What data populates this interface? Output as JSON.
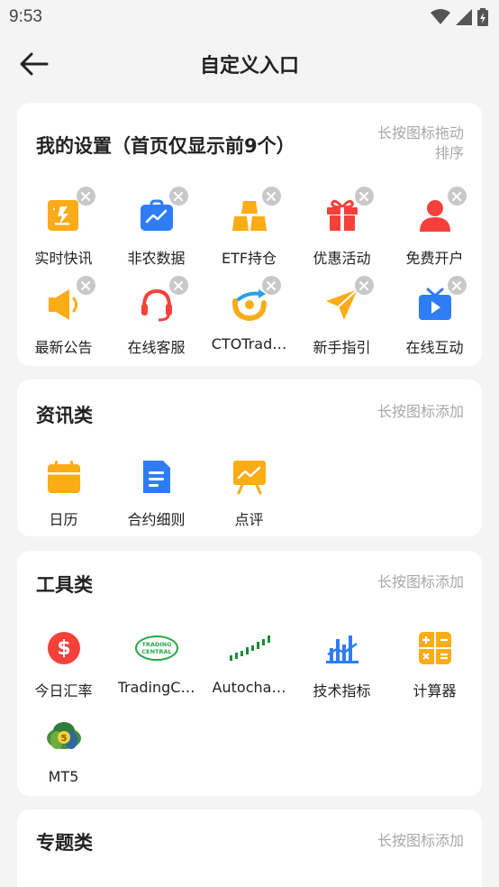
{
  "status": {
    "time": "9:53"
  },
  "header": {
    "title": "自定义入口"
  },
  "my_settings": {
    "title": "我的设置（首页仅显示前9个）",
    "hint_line1": "长按图标拖动",
    "hint_line2": "排序",
    "items": [
      {
        "label": "实时快讯",
        "icon": "flash-news-icon"
      },
      {
        "label": "非农数据",
        "icon": "briefcase-chart-icon"
      },
      {
        "label": "ETF持仓",
        "icon": "gold-bars-icon"
      },
      {
        "label": "优惠活动",
        "icon": "gift-icon"
      },
      {
        "label": "免费开户",
        "icon": "user-icon"
      },
      {
        "label": "最新公告",
        "icon": "speaker-icon"
      },
      {
        "label": "在线客服",
        "icon": "headset-icon"
      },
      {
        "label": "CTOTrad…",
        "icon": "cto-logo-icon"
      },
      {
        "label": "新手指引",
        "icon": "paper-plane-icon"
      },
      {
        "label": "在线互动",
        "icon": "tv-play-icon"
      }
    ]
  },
  "news": {
    "title": "资讯类",
    "hint": "长按图标添加",
    "items": [
      {
        "label": "日历",
        "icon": "calendar-icon"
      },
      {
        "label": "合约细则",
        "icon": "document-icon"
      },
      {
        "label": "点评",
        "icon": "easel-chart-icon"
      }
    ]
  },
  "tools": {
    "title": "工具类",
    "hint": "长按图标添加",
    "items": [
      {
        "label": "今日汇率",
        "icon": "dollar-icon"
      },
      {
        "label": "TradingC…",
        "icon": "trading-central-logo-icon"
      },
      {
        "label": "Autocha…",
        "icon": "autochartist-logo-icon"
      },
      {
        "label": "技术指标",
        "icon": "bar-chart-icon"
      },
      {
        "label": "计算器",
        "icon": "calculator-icon"
      },
      {
        "label": "MT5",
        "icon": "mt5-logo-icon"
      }
    ]
  },
  "topics": {
    "title": "专题类",
    "hint": "长按图标添加"
  },
  "misc": {
    "trading_central_text1": "TRADING",
    "trading_central_text2": "CENTRAL",
    "mt5_badge": "5"
  },
  "colors": {
    "orange": "#fbac17",
    "blue": "#2f7df6",
    "red": "#f5413a",
    "green": "#2aa84a"
  }
}
